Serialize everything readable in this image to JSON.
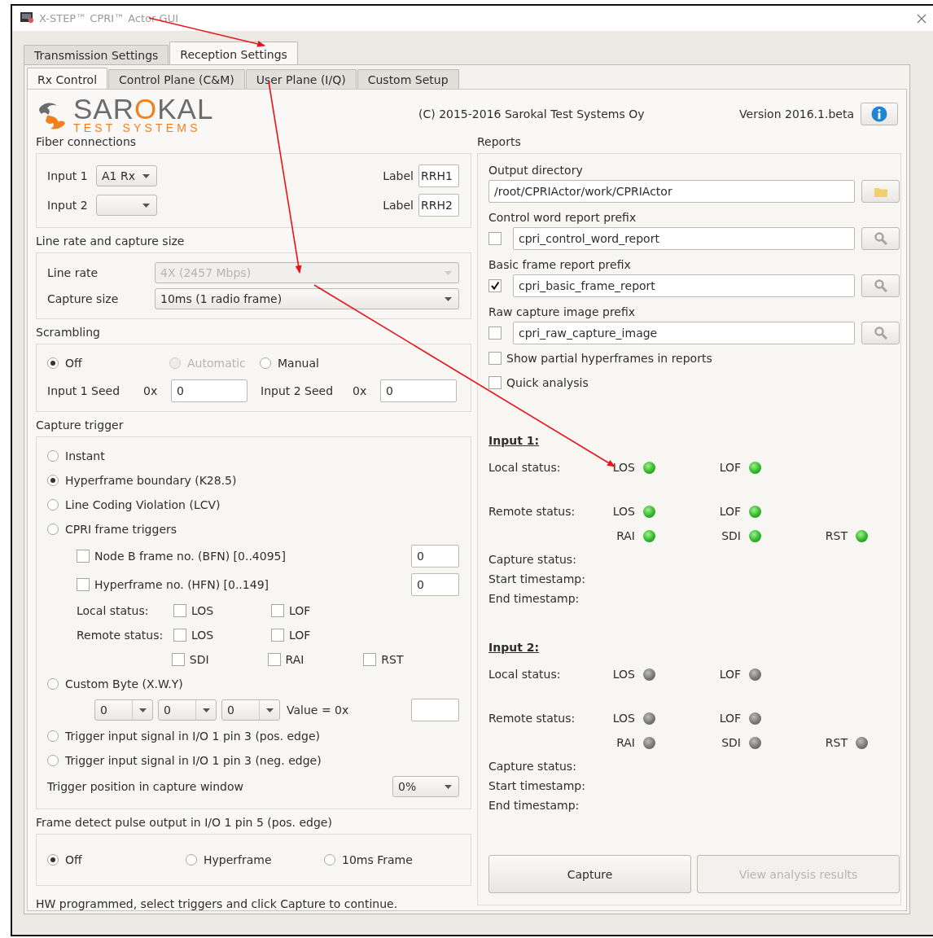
{
  "window": {
    "title": "X-STEP™ CPRI™ Actor GUI"
  },
  "tabs": [
    {
      "label": "Transmission Settings",
      "selected": false
    },
    {
      "label": "Reception Settings",
      "selected": true
    }
  ],
  "subtabs": [
    {
      "label": "Rx Control",
      "selected": true
    },
    {
      "label": "Control Plane (C&M)",
      "selected": false
    },
    {
      "label": "User Plane (I/Q)",
      "selected": false
    },
    {
      "label": "Custom Setup",
      "selected": false
    }
  ],
  "header": {
    "logo": [
      {
        "text": "SAR",
        "color": "#6b6c6e"
      },
      {
        "text": "O",
        "color": "#f2801f"
      },
      {
        "text": "KAL",
        "color": "#6b6c6e"
      }
    ],
    "tagline": "TEST SYSTEMS",
    "copyright": "(C) 2015-2016 Sarokal Test Systems Oy",
    "version": "Version 2016.1.beta"
  },
  "fiber": {
    "title": "Fiber connections",
    "inputs": [
      {
        "label": "Input 1",
        "value": "A1 Rx",
        "caption": "Label",
        "name": "RRH1"
      },
      {
        "label": "Input 2",
        "caption": "Label",
        "name": "RRH2"
      }
    ]
  },
  "line_rate": {
    "title": "Line rate and capture size",
    "rows": [
      {
        "label": "Line rate",
        "value": "4X (2457 Mbps)",
        "disabled": true
      },
      {
        "label": "Capture size",
        "value": "10ms (1 radio frame)",
        "disabled": false
      }
    ]
  },
  "scrambling": {
    "title": "Scrambling",
    "options": [
      {
        "label": "Off",
        "selected": true,
        "disabled": false
      },
      {
        "label": "Automatic",
        "selected": false,
        "disabled": true
      },
      {
        "label": "Manual",
        "selected": false,
        "disabled": false
      }
    ],
    "seeds": [
      {
        "label": "Input 1 Seed",
        "prefix": "0x",
        "value": "0"
      },
      {
        "label": "Input 2 Seed",
        "prefix": "0x",
        "value": "0"
      }
    ]
  },
  "capture_trigger": {
    "title": "Capture trigger",
    "items": [
      {
        "kind": "radio",
        "label": "Instant",
        "selected": false
      },
      {
        "kind": "radio",
        "label": "Hyperframe boundary (K28.5)",
        "selected": true
      },
      {
        "kind": "radio",
        "label": "Line Coding Violation (LCV)",
        "selected": false
      },
      {
        "kind": "radio",
        "label": "CPRI frame triggers",
        "selected": false
      },
      {
        "kind": "check_field",
        "label": "Node B frame no. (BFN) [0..4095]",
        "checked": false,
        "value": "0"
      },
      {
        "kind": "check_field",
        "label": "Hyperframe no. (HFN) [0..149]",
        "checked": false,
        "value": "0"
      },
      {
        "kind": "status_row",
        "label": "Local status:",
        "flags": [
          {
            "label": "LOS",
            "checked": false
          },
          {
            "label": "LOF",
            "checked": false
          }
        ]
      },
      {
        "kind": "status_row",
        "label": "Remote status:",
        "flags": [
          {
            "label": "LOS",
            "checked": false
          },
          {
            "label": "LOF",
            "checked": false
          }
        ]
      },
      {
        "kind": "status_row",
        "flags": [
          {
            "label": "SDI",
            "checked": false
          },
          {
            "label": "RAI",
            "checked": false
          },
          {
            "label": "RST",
            "checked": false
          }
        ]
      },
      {
        "kind": "radio",
        "label": "Custom Byte (X.W.Y)",
        "selected": false
      },
      {
        "kind": "byte_row",
        "selects": [
          "0",
          "0",
          "0"
        ],
        "caption": "Value = 0x"
      },
      {
        "kind": "radio",
        "label": "Trigger input signal in I/O 1 pin 3 (pos. edge)",
        "selected": false
      },
      {
        "kind": "radio",
        "label": "Trigger input signal in I/O 1 pin 3 (neg. edge)",
        "selected": false
      },
      {
        "kind": "select_row",
        "label": "Trigger position in capture window",
        "value": "0%"
      }
    ]
  },
  "frame_pulse": {
    "title": "Frame detect pulse output in I/O 1 pin 5 (pos. edge)",
    "options": [
      {
        "label": "Off",
        "selected": true
      },
      {
        "label": "Hyperframe",
        "selected": false
      },
      {
        "label": "10ms Frame",
        "selected": false
      }
    ]
  },
  "status_message": "HW programmed, select triggers and click Capture to continue.",
  "reports": {
    "title": "Reports",
    "output_directory": {
      "label": "Output directory",
      "value": "/root/CPRIActor/work/CPRIActor"
    },
    "prefixes": [
      {
        "label": "Control word report prefix",
        "checked": false,
        "value": "cpri_control_word_report"
      },
      {
        "label": "Basic frame report prefix",
        "checked": true,
        "value": "cpri_basic_frame_report"
      },
      {
        "label": "Raw capture image prefix",
        "checked": false,
        "value": "cpri_raw_capture_image"
      }
    ],
    "options": [
      {
        "label": "Show partial hyperframes in reports",
        "checked": false
      },
      {
        "label": "Quick analysis",
        "checked": false
      }
    ]
  },
  "inputs": [
    {
      "title": "Input 1:",
      "rows": [
        {
          "label": "Local status:",
          "indicators": [
            {
              "label": "LOS",
              "on": true
            },
            {
              "label": "LOF",
              "on": true
            }
          ]
        },
        {
          "label": "Remote status:",
          "indicators": [
            {
              "label": "LOS",
              "on": true
            },
            {
              "label": "LOF",
              "on": true
            }
          ]
        },
        {
          "indicators": [
            {
              "label": "RAI",
              "on": true
            },
            {
              "label": "SDI",
              "on": true
            },
            {
              "label": "RST",
              "on": true
            }
          ]
        }
      ],
      "fields": [
        "Capture status:",
        "Start timestamp:",
        "End timestamp:"
      ]
    },
    {
      "title": "Input 2:",
      "rows": [
        {
          "label": "Local status:",
          "indicators": [
            {
              "label": "LOS",
              "on": false
            },
            {
              "label": "LOF",
              "on": false
            }
          ]
        },
        {
          "label": "Remote status:",
          "indicators": [
            {
              "label": "LOS",
              "on": false
            },
            {
              "label": "LOF",
              "on": false
            }
          ]
        },
        {
          "indicators": [
            {
              "label": "RAI",
              "on": false
            },
            {
              "label": "SDI",
              "on": false
            },
            {
              "label": "RST",
              "on": false
            }
          ]
        }
      ],
      "fields": [
        "Capture status:",
        "Start timestamp:",
        "End timestamp:"
      ]
    }
  ],
  "buttons": [
    {
      "label": "Capture",
      "disabled": false
    },
    {
      "label": "View analysis results",
      "disabled": true
    }
  ]
}
